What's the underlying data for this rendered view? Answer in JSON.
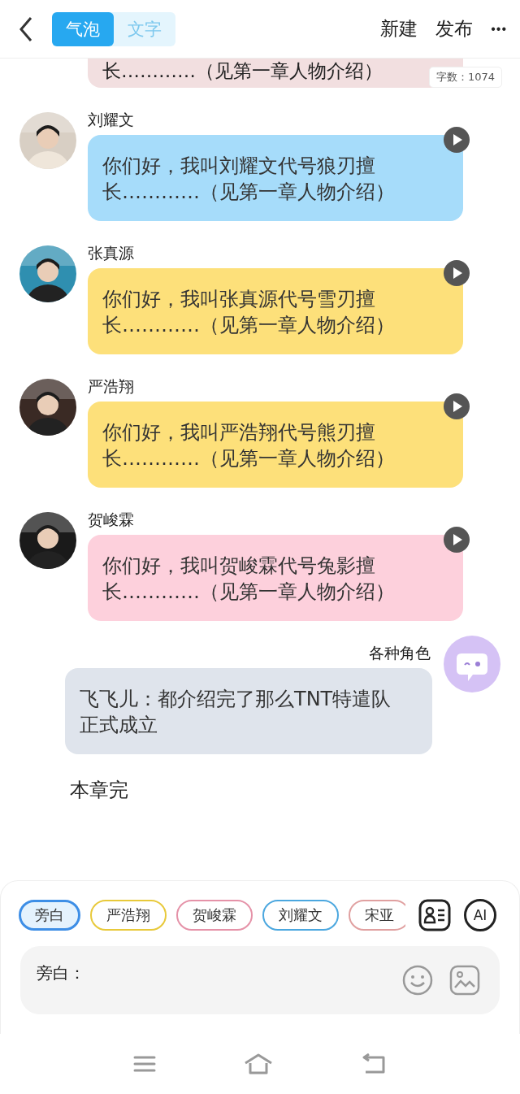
{
  "header": {
    "tabs": [
      {
        "label": "气泡",
        "selected": true
      },
      {
        "label": "文字",
        "selected": false
      }
    ],
    "actions": [
      "新建",
      "发布"
    ],
    "more": "•••"
  },
  "partial_bubble": {
    "text": "长…………（见第一章人物介绍）",
    "color": "#f2dfe0"
  },
  "word_count": "字数：1074",
  "messages": [
    {
      "name": "刘耀文",
      "text": "你们好，我叫刘耀文代号狼刃擅长…………（见第一章人物介绍）",
      "color": "#a6dcfa"
    },
    {
      "name": "张真源",
      "text": "你们好，我叫张真源代号雪刃擅长…………（见第一章人物介绍）",
      "color": "#fde07a"
    },
    {
      "name": "严浩翔",
      "text": "你们好，我叫严浩翔代号熊刃擅长…………（见第一章人物介绍）",
      "color": "#fde07a"
    },
    {
      "name": "贺峻霖",
      "text": "你们好，我叫贺峻霖代号兔影擅长…………（见第一章人物介绍）",
      "color": "#fdd0dc"
    }
  ],
  "narrator": {
    "name": "各种角色",
    "text": "飞飞儿：都介绍完了那么TNT特遣队正式成立"
  },
  "chapter_end": "本章完",
  "chips": [
    {
      "label": "旁白",
      "selected": true,
      "color": "#3d8ee6"
    },
    {
      "label": "严浩翔",
      "selected": false,
      "color": "#e8c93a"
    },
    {
      "label": "贺峻霖",
      "selected": false,
      "color": "#e592a8"
    },
    {
      "label": "刘耀文",
      "selected": false,
      "color": "#4ba7df"
    },
    {
      "label": "宋亚",
      "selected": false,
      "color": "#e0a0a0"
    }
  ],
  "ai_button": "AI",
  "input": {
    "label": "旁白："
  }
}
